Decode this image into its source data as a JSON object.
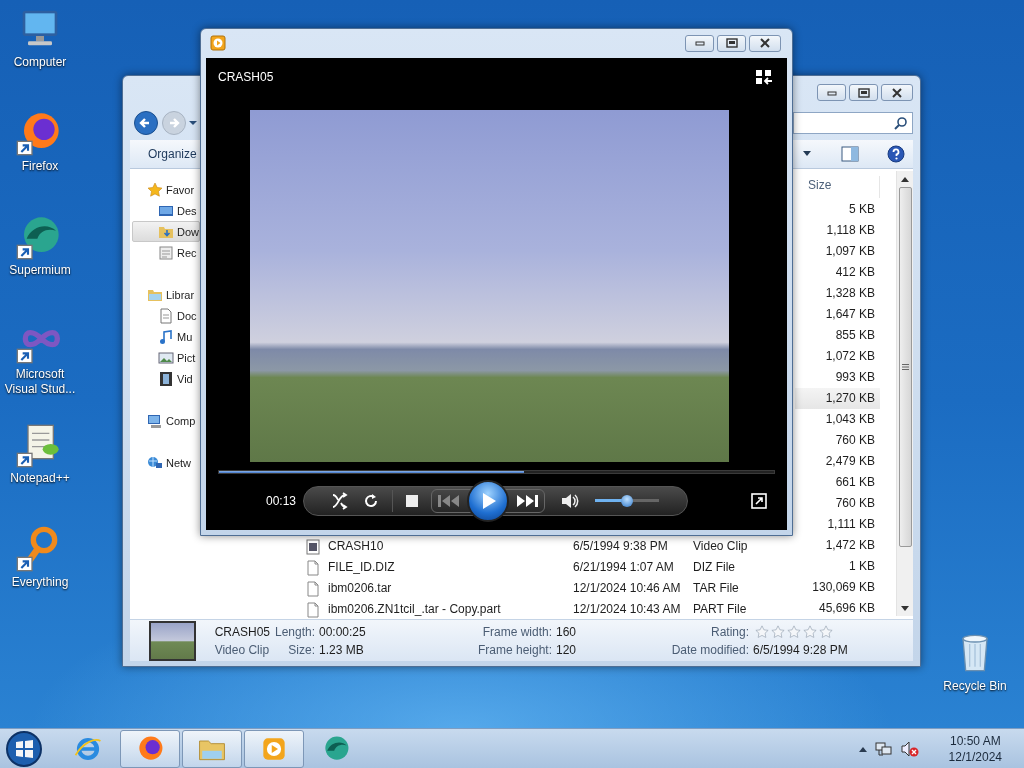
{
  "desktop_icons": [
    {
      "label": "Computer",
      "kind": "computer",
      "shortcut": false
    },
    {
      "label": "Firefox",
      "kind": "firefox",
      "shortcut": true
    },
    {
      "label": "Supermium",
      "kind": "supermium",
      "shortcut": true
    },
    {
      "label": "Microsoft Visual Stud...",
      "kind": "visualstudio",
      "shortcut": true
    },
    {
      "label": "Notepad++",
      "kind": "notepad",
      "shortcut": true
    },
    {
      "label": "Everything",
      "kind": "everything",
      "shortcut": true
    }
  ],
  "recycle_bin": {
    "label": "Recycle Bin"
  },
  "explorer": {
    "nav_buttons": [
      {
        "kind": "back",
        "disabled": false
      },
      {
        "kind": "forward",
        "disabled": true
      }
    ],
    "toolbar": {
      "organize": "Organize"
    },
    "nav_pane": [
      {
        "label": "Favor",
        "kind": "favorites",
        "selected": false,
        "children": [
          {
            "label": "Des",
            "kind": "desktop",
            "selected": false
          },
          {
            "label": "Dow",
            "kind": "downloads",
            "selected": true
          },
          {
            "label": "Rec",
            "kind": "recent",
            "selected": false
          }
        ]
      },
      {
        "label": "Librar",
        "kind": "libraries",
        "selected": false,
        "children": [
          {
            "label": "Doc",
            "kind": "documents",
            "selected": false
          },
          {
            "label": "Mu",
            "kind": "music",
            "selected": false
          },
          {
            "label": "Pict",
            "kind": "pictures",
            "selected": false
          },
          {
            "label": "Vid",
            "kind": "videos",
            "selected": false
          }
        ]
      },
      {
        "label": "Comp",
        "kind": "computer",
        "selected": false
      },
      {
        "label": "Netw",
        "kind": "network",
        "selected": false
      }
    ],
    "file_list": {
      "size_header": "Size",
      "rows": [
        {
          "size": "5 KB",
          "hovered": false
        },
        {
          "size": "1,118 KB",
          "hovered": false
        },
        {
          "size": "1,097 KB",
          "hovered": false
        },
        {
          "size": "412 KB",
          "hovered": false
        },
        {
          "size": "1,328 KB",
          "hovered": false
        },
        {
          "size": "1,647 KB",
          "hovered": false
        },
        {
          "size": "855 KB",
          "hovered": false
        },
        {
          "size": "1,072 KB",
          "hovered": false
        },
        {
          "size": "993 KB",
          "hovered": false
        },
        {
          "size": "1,270 KB",
          "hovered": true
        },
        {
          "size": "1,043 KB",
          "hovered": false
        },
        {
          "size": "760 KB",
          "hovered": false
        },
        {
          "size": "2,479 KB",
          "hovered": false
        },
        {
          "size": "661 KB",
          "hovered": false
        },
        {
          "size": "760 KB",
          "hovered": false
        },
        {
          "size": "1,111 KB",
          "hovered": false
        },
        {
          "kind": "video",
          "name": "CRASH10",
          "date": "6/5/1994 9:38 PM",
          "type": "Video Clip",
          "size": "1,472 KB",
          "hovered": false
        },
        {
          "kind": "file",
          "name": "FILE_ID.DIZ",
          "date": "6/21/1994 1:07 AM",
          "type": "DIZ File",
          "size": "1 KB",
          "hovered": false
        },
        {
          "kind": "file",
          "name": "ibm0206.tar",
          "date": "12/1/2024 10:46 AM",
          "type": "TAR File",
          "size": "130,069 KB",
          "hovered": false
        },
        {
          "kind": "file",
          "name": "ibm0206.ZN1tcil_.tar - Copy.part",
          "date": "12/1/2024 10:43 AM",
          "type": "PART File",
          "size": "45,696 KB",
          "hovered": false
        }
      ]
    },
    "details": {
      "name": "CRASH05",
      "type": "Video Clip",
      "columns": [
        [
          {
            "kind": "text",
            "label": "Length:",
            "value": "00:00:25"
          },
          {
            "kind": "text",
            "label": "Size:",
            "value": "1.23 MB"
          }
        ],
        [
          {
            "kind": "text",
            "label": "Frame width:",
            "value": "160"
          },
          {
            "kind": "text",
            "label": "Frame height:",
            "value": "120"
          }
        ],
        [
          {
            "kind": "rating",
            "label": "Rating:",
            "stars": 0
          },
          {
            "kind": "text",
            "label": "Date modified:",
            "value": "6/5/1994 9:28 PM"
          }
        ]
      ]
    }
  },
  "player": {
    "title": "CRASH05",
    "seek": {
      "level": 0.55
    },
    "time": "00:13",
    "playing": false,
    "volume": {
      "level": 0.5
    }
  },
  "taskbar": {
    "apps": [
      {
        "kind": "ie",
        "running": false
      },
      {
        "kind": "firefox",
        "running": true
      },
      {
        "kind": "explorer",
        "running": true
      },
      {
        "kind": "mediaplayer",
        "running": true
      },
      {
        "kind": "supermium",
        "running": false
      }
    ],
    "clock": {
      "time": "10:50 AM",
      "date": "12/1/2024"
    }
  }
}
